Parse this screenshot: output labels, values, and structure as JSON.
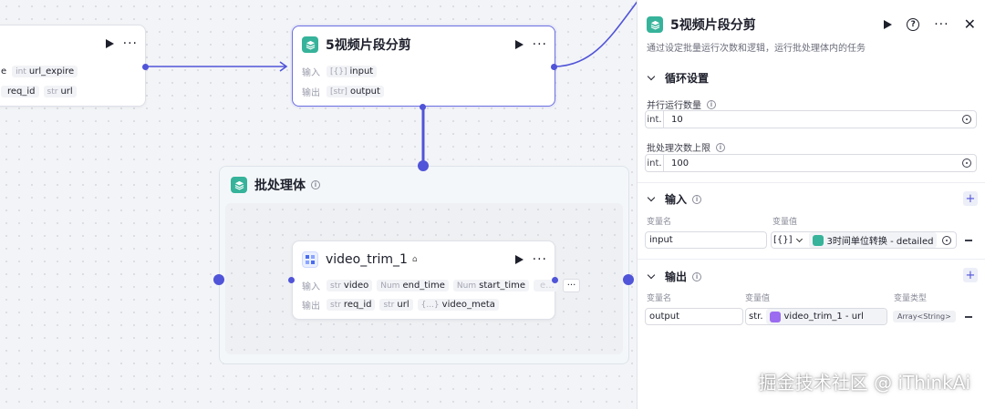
{
  "canvas": {
    "left_node": {
      "outputs": [
        {
          "type": "int",
          "name": "url_expire"
        },
        {
          "type": "",
          "name": "req_id"
        },
        {
          "type": "str",
          "name": "url"
        }
      ],
      "partial_title_suffix": "e"
    },
    "loop_node": {
      "title": "5视频片段分剪",
      "input_label": "输入",
      "output_label": "输出",
      "input": {
        "type": "[{}]",
        "name": "input"
      },
      "output": {
        "type": "[str]",
        "name": "output"
      }
    },
    "batch_group": {
      "title": "批处理体",
      "info": "i"
    },
    "trim_node": {
      "title": "video_trim_1",
      "input_label": "输入",
      "output_label": "输出",
      "inputs": [
        {
          "type": "str",
          "name": "video"
        },
        {
          "type": "Num",
          "name": "end_time"
        },
        {
          "type": "Num",
          "name": "start_time"
        },
        {
          "type": "",
          "name": "e..."
        }
      ],
      "outputs": [
        {
          "type": "str",
          "name": "req_id"
        },
        {
          "type": "str",
          "name": "url"
        },
        {
          "type": "{...}",
          "name": "video_meta"
        }
      ],
      "overflow": "···"
    }
  },
  "panel": {
    "title": "5视频片段分剪",
    "description": "通过设定批量运行次数和逻辑，运行批处理体内的任务",
    "loop_section": {
      "title": "循环设置",
      "parallel_label": "并行运行数量",
      "parallel_prefix": "int.",
      "parallel_value": "10",
      "max_label": "批处理次数上限",
      "max_prefix": "int.",
      "max_value": "100"
    },
    "input_section": {
      "title": "输入",
      "col_name": "变量名",
      "col_value": "变量值",
      "rows": [
        {
          "name": "input",
          "type_prefix": "[{}]",
          "ref": "3时间单位转换 - detailed"
        }
      ]
    },
    "output_section": {
      "title": "输出",
      "col_name": "变量名",
      "col_value": "变量值",
      "col_type": "变量类型",
      "rows": [
        {
          "name": "output",
          "type_prefix": "str.",
          "ref": "video_trim_1 - url",
          "var_type": "Array<String>"
        }
      ]
    }
  },
  "watermark": "掘金技术社区 @ iThinkAi",
  "colors": {
    "accent": "#5054d8",
    "node_icon": "#36b39a",
    "selected_border": "#6b6fe0"
  }
}
